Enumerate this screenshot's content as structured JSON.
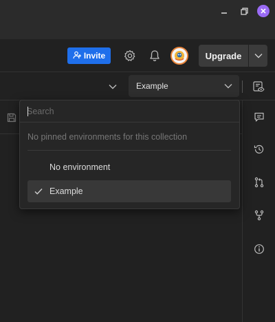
{
  "window": {
    "controls": {
      "minimize": "minimize-icon",
      "maximize": "restore-icon",
      "close": "close-icon"
    },
    "close_color": "#9a6bf5"
  },
  "header": {
    "invite_label": "Invite",
    "upgrade_label": "Upgrade",
    "icons": [
      "add-user-icon",
      "gear-icon",
      "bell-icon",
      "chevron-down-icon"
    ],
    "accent": "#1f6feb"
  },
  "env_bar": {
    "selected_environment": "Example",
    "icons": [
      "chevron-down-icon",
      "environment-quick-look-icon"
    ]
  },
  "right_sidebar": {
    "icons": [
      "comments-icon",
      "history-icon",
      "pull-request-icon",
      "fork-icon",
      "info-icon"
    ]
  },
  "environment_dropdown": {
    "search_placeholder": "Search",
    "no_pinned_text": "No pinned environments for this collection",
    "items": [
      {
        "label": "No environment",
        "selected": false
      },
      {
        "label": "Example",
        "selected": true
      }
    ]
  }
}
